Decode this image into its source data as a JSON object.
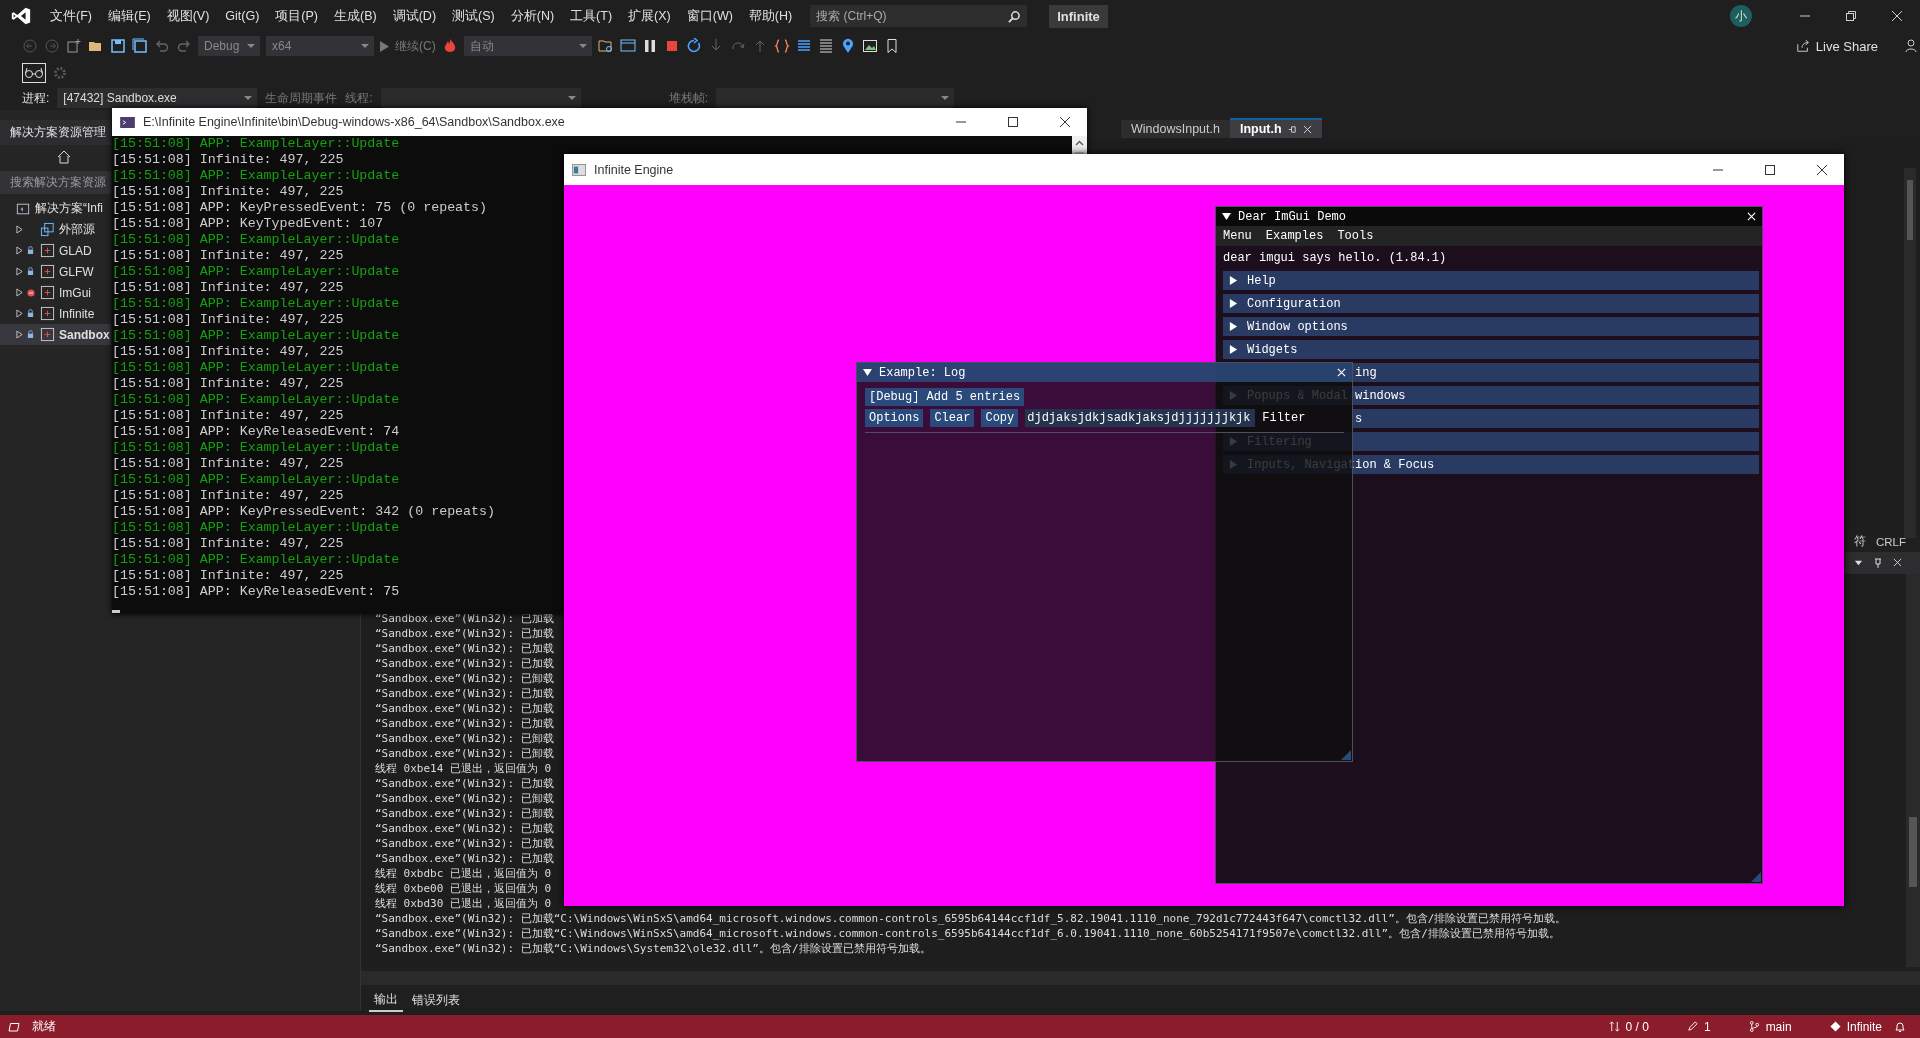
{
  "menu_bar": {
    "items": [
      "文件(F)",
      "编辑(E)",
      "视图(V)",
      "Git(G)",
      "项目(P)",
      "生成(B)",
      "调试(D)",
      "测试(S)",
      "分析(N)",
      "工具(T)",
      "扩展(X)",
      "窗口(W)",
      "帮助(H)"
    ],
    "search": {
      "placeholder": "搜索 (Ctrl+Q)"
    },
    "solution_name": "Infinite",
    "account_initial": "小"
  },
  "toolbar": {
    "configuration": "Debug",
    "platform": "x64",
    "continue": "继续(C)",
    "auto": "自动",
    "live_share": "Live Share"
  },
  "debug_location": {
    "process_label": "进程:",
    "process": "[47432] Sandbox.exe",
    "lifecycle": "生命周期事件",
    "thread_label": "线程:",
    "stack_label": "堆栈帧:"
  },
  "solution_explorer": {
    "title": "解决方案资源管理",
    "search_placeholder": "搜索解决方案资源",
    "root": "解决方案“Infi",
    "items": [
      {
        "label": "外部源",
        "kind": "folder",
        "locked": false,
        "pending": false,
        "selected": false
      },
      {
        "label": "GLAD",
        "kind": "project",
        "locked": true,
        "pending": false,
        "selected": false
      },
      {
        "label": "GLFW",
        "kind": "project",
        "locked": true,
        "pending": false,
        "selected": false
      },
      {
        "label": "ImGui",
        "kind": "project",
        "locked": false,
        "pending": true,
        "selected": false
      },
      {
        "label": "Infinite",
        "kind": "project",
        "locked": true,
        "pending": false,
        "selected": false
      },
      {
        "label": "Sandbox",
        "kind": "project",
        "locked": true,
        "pending": false,
        "selected": true
      }
    ]
  },
  "editor_tabs": [
    {
      "label": "WindowsInput.h",
      "selected": false
    },
    {
      "label": "Input.h",
      "selected": true
    }
  ],
  "editor_status": {
    "encoding": "符",
    "line_ending": "CRLF"
  },
  "console": {
    "title": "E:\\Infinite Engine\\Infinite\\bin\\Debug-windows-x86_64\\Sandbox\\Sandbox.exe",
    "lines": [
      {
        "text": "[15:51:08] APP: ExampleLayer::Update",
        "color": "#13a10e"
      },
      {
        "text": "[15:51:08] Infinite: 497, 225",
        "color": "#cccccc"
      },
      {
        "text": "[15:51:08] APP: ExampleLayer::Update",
        "color": "#13a10e"
      },
      {
        "text": "[15:51:08] Infinite: 497, 225",
        "color": "#cccccc"
      },
      {
        "text": "[15:51:08] APP: KeyPressedEvent: 75 (0 repeats)",
        "color": "#cccccc"
      },
      {
        "text": "[15:51:08] APP: KeyTypedEvent: 107",
        "color": "#cccccc"
      },
      {
        "text": "[15:51:08] APP: ExampleLayer::Update",
        "color": "#13a10e"
      },
      {
        "text": "[15:51:08] Infinite: 497, 225",
        "color": "#cccccc"
      },
      {
        "text": "[15:51:08] APP: ExampleLayer::Update",
        "color": "#13a10e"
      },
      {
        "text": "[15:51:08] Infinite: 497, 225",
        "color": "#cccccc"
      },
      {
        "text": "[15:51:08] APP: ExampleLayer::Update",
        "color": "#13a10e"
      },
      {
        "text": "[15:51:08] Infinite: 497, 225",
        "color": "#cccccc"
      },
      {
        "text": "[15:51:08] APP: ExampleLayer::Update",
        "color": "#13a10e"
      },
      {
        "text": "[15:51:08] Infinite: 497, 225",
        "color": "#cccccc"
      },
      {
        "text": "[15:51:08] APP: ExampleLayer::Update",
        "color": "#13a10e"
      },
      {
        "text": "[15:51:08] Infinite: 497, 225",
        "color": "#cccccc"
      },
      {
        "text": "[15:51:08] APP: ExampleLayer::Update",
        "color": "#13a10e"
      },
      {
        "text": "[15:51:08] Infinite: 497, 225",
        "color": "#cccccc"
      },
      {
        "text": "[15:51:08] APP: KeyReleasedEvent: 74",
        "color": "#cccccc"
      },
      {
        "text": "[15:51:08] APP: ExampleLayer::Update",
        "color": "#13a10e"
      },
      {
        "text": "[15:51:08] Infinite: 497, 225",
        "color": "#cccccc"
      },
      {
        "text": "[15:51:08] APP: ExampleLayer::Update",
        "color": "#13a10e"
      },
      {
        "text": "[15:51:08] Infinite: 497, 225",
        "color": "#cccccc"
      },
      {
        "text": "[15:51:08] APP: KeyPressedEvent: 342 (0 repeats)",
        "color": "#cccccc"
      },
      {
        "text": "[15:51:08] APP: ExampleLayer::Update",
        "color": "#13a10e"
      },
      {
        "text": "[15:51:08] Infinite: 497, 225",
        "color": "#cccccc"
      },
      {
        "text": "[15:51:08] APP: ExampleLayer::Update",
        "color": "#13a10e"
      },
      {
        "text": "[15:51:08] Infinite: 497, 225",
        "color": "#cccccc"
      },
      {
        "text": "[15:51:08] APP: KeyReleasedEvent: 75",
        "color": "#cccccc"
      }
    ]
  },
  "output": {
    "lines": [
      "“Sandbox.exe”(Win32): 已加载",
      "“Sandbox.exe”(Win32): 已加载",
      "“Sandbox.exe”(Win32): 已加载",
      "“Sandbox.exe”(Win32): 已加载",
      "“Sandbox.exe”(Win32): 已卸载",
      "“Sandbox.exe”(Win32): 已加载",
      "“Sandbox.exe”(Win32): 已加载",
      "“Sandbox.exe”(Win32): 已加载",
      "“Sandbox.exe”(Win32): 已卸载",
      "“Sandbox.exe”(Win32): 已卸载",
      "线程 0xbe14 已退出，返回值为 0",
      "“Sandbox.exe”(Win32): 已加载",
      "“Sandbox.exe”(Win32): 已卸载",
      "“Sandbox.exe”(Win32): 已卸载",
      "“Sandbox.exe”(Win32): 已加载",
      "“Sandbox.exe”(Win32): 已加载",
      "“Sandbox.exe”(Win32): 已加载",
      "线程 0xbdbc 已退出，返回值为 0",
      "线程 0xbe00 已退出，返回值为 0",
      "线程 0xbd30 已退出，返回值为 0",
      "“Sandbox.exe”(Win32): 已加载“C:\\Windows\\WinSxS\\amd64_microsoft.windows.common-controls_6595b64144ccf1df_5.82.19041.1110_none_792d1c772443f647\\comctl32.dll”。包含/排除设置已禁用符号加载。",
      "“Sandbox.exe”(Win32): 已加载“C:\\Windows\\WinSxS\\amd64_microsoft.windows.common-controls_6595b64144ccf1df_6.0.19041.1110_none_60b5254171f9507e\\comctl32.dll”。包含/排除设置已禁用符号加载。",
      "“Sandbox.exe”(Win32): 已加载“C:\\Windows\\System32\\ole32.dll”。包含/排除设置已禁用符号加载。"
    ],
    "tabs": [
      {
        "label": "输出",
        "selected": true
      },
      {
        "label": "错误列表",
        "selected": false
      }
    ]
  },
  "engine_window": {
    "title": "Infinite Engine",
    "demo": {
      "title": "Dear ImGui Demo",
      "menus": [
        "Menu",
        "Examples",
        "Tools"
      ],
      "greeting": "dear imgui says hello. (1.84.1)",
      "headers": [
        {
          "label": "Help",
          "expanded": false
        },
        {
          "label": "Configuration",
          "expanded": false
        },
        {
          "label": "Window options",
          "expanded": false
        },
        {
          "label": "Widgets",
          "expanded": false
        },
        {
          "label": "ing",
          "kind": "covered",
          "expanded": false
        },
        {
          "label": "Popups & Modal windows",
          "expanded": false
        },
        {
          "label": "s",
          "kind": "covered",
          "expanded": false
        },
        {
          "label": "Filtering",
          "expanded": false
        },
        {
          "label": "Inputs, Navigation & Focus",
          "expanded": false
        }
      ]
    },
    "log": {
      "title": "Example: Log",
      "add_button": "[Debug] Add 5 entries",
      "buttons": [
        "Options",
        "Clear",
        "Copy"
      ],
      "filter": {
        "value": "djdjaksjdkjsadkjaksjdjjjjjjjkjk",
        "label": "Filter"
      }
    }
  },
  "status_bar": {
    "state": "就绪",
    "changes": "0 / 0",
    "pending": "1",
    "branch": "main",
    "repository": "Infinite"
  }
}
